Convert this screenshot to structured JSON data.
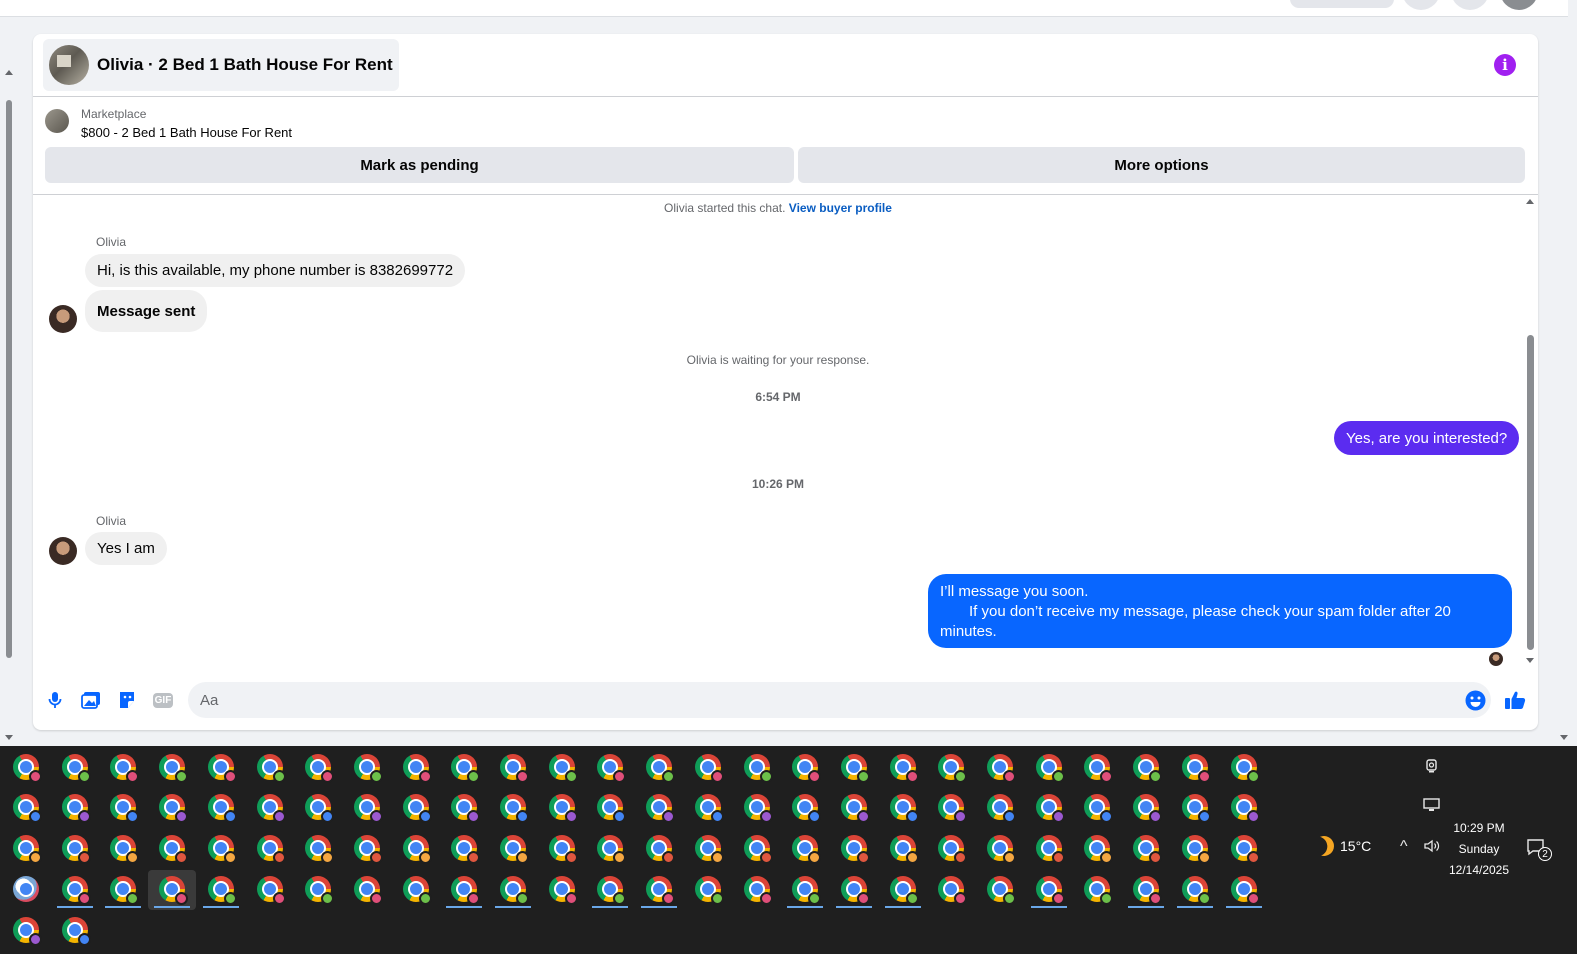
{
  "chat": {
    "title": "Olivia · 2 Bed 1 Bath House For Rent",
    "marketplace_label": "Marketplace",
    "listing": "$800 - 2 Bed 1 Bath House For Rent",
    "mark_pending_label": "Mark as pending",
    "more_options_label": "More options",
    "accent_color": "#a020f0"
  },
  "messages": {
    "started_text": "Olivia started this chat.",
    "view_profile_label": "View buyer profile",
    "sender_name": "Olivia",
    "msg1": "Hi, is this available, my phone number is 8382699772",
    "msg2": "Message sent",
    "waiting_text": "Olivia is waiting for your response.",
    "time1": "6:54 PM",
    "reply1": "Yes, are you interested?",
    "time2": "10:26 PM",
    "sender_name_2": "Olivia",
    "msg3": "Yes I am",
    "reply2_line1": "I’ll message you soon.",
    "reply2_line2": "If you don’t receive my message, please check your spam folder after 20 minutes.",
    "reply1_color": "#5b2cf0",
    "reply2_color": "#0866ff"
  },
  "composer": {
    "placeholder": "Aa",
    "icons": [
      "microphone-icon",
      "image-icon",
      "sticker-icon",
      "gif-icon",
      "emoji-icon",
      "thumbs-up-icon"
    ],
    "gif_label": "GIF"
  },
  "taskbar": {
    "temperature": "15°C",
    "time": "10:29 PM",
    "day": "Sunday",
    "date": "12/14/2025",
    "notification_count": "2"
  }
}
